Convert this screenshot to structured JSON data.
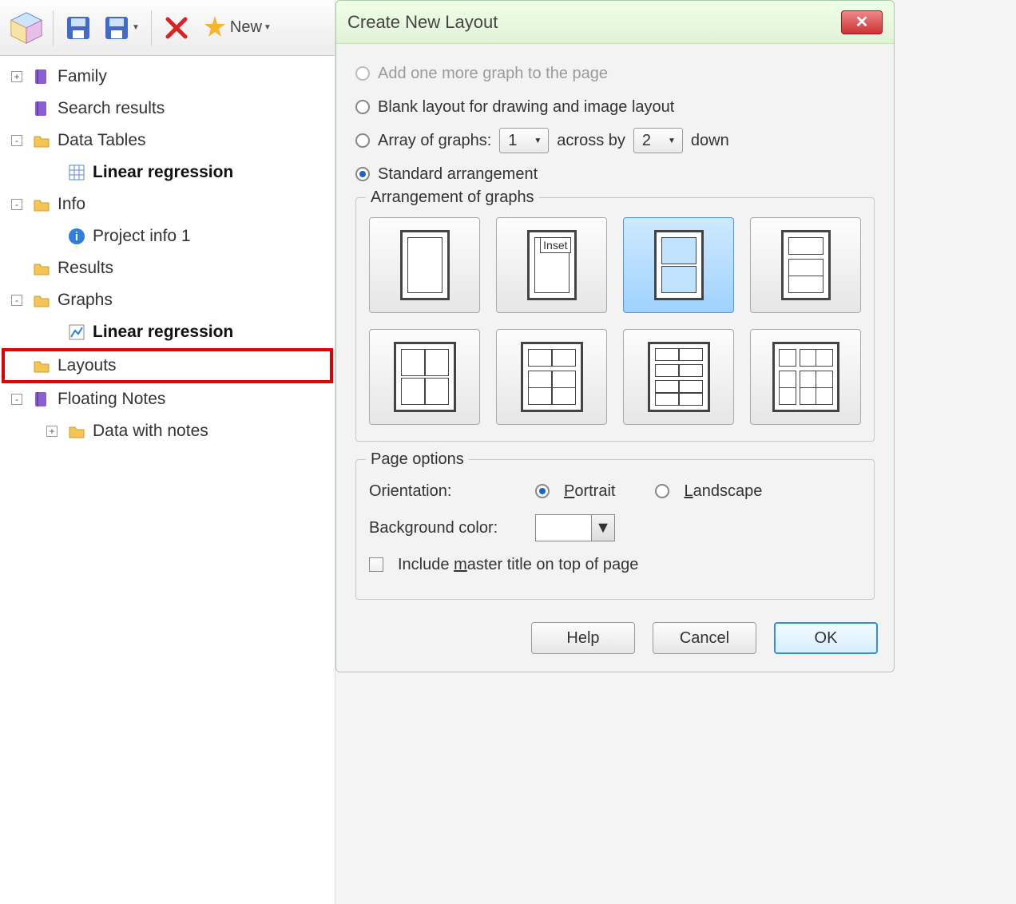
{
  "toolbar": {
    "new_label": "New"
  },
  "tree": {
    "items": [
      {
        "label": "Family",
        "bold": false,
        "expander": "+",
        "icon": "book-purple"
      },
      {
        "label": "Search results",
        "bold": false,
        "expander": null,
        "icon": "book-purple"
      },
      {
        "label": "Data Tables",
        "bold": false,
        "expander": "-",
        "icon": "folder-yellow"
      },
      {
        "label": "Linear regression",
        "bold": true,
        "expander": null,
        "icon": "table",
        "child": true
      },
      {
        "label": "Info",
        "bold": false,
        "expander": "-",
        "icon": "folder-yellow"
      },
      {
        "label": "Project info 1",
        "bold": false,
        "expander": null,
        "icon": "info-blue",
        "child": true
      },
      {
        "label": "Results",
        "bold": false,
        "expander": null,
        "icon": "folder-yellow"
      },
      {
        "label": "Graphs",
        "bold": false,
        "expander": "-",
        "icon": "folder-yellow"
      },
      {
        "label": "Linear regression",
        "bold": true,
        "expander": null,
        "icon": "chart",
        "child": true
      },
      {
        "label": "Layouts",
        "bold": false,
        "expander": null,
        "icon": "folder-yellow",
        "highlight": true
      },
      {
        "label": "Floating Notes",
        "bold": false,
        "expander": "-",
        "icon": "book-purple"
      },
      {
        "label": "Data with notes",
        "bold": false,
        "expander": "+",
        "icon": "folder-yellow",
        "child": true
      }
    ]
  },
  "dialog": {
    "title": "Create New Layout",
    "radios": {
      "add_more": "Add one more graph to the page",
      "blank": "Blank layout for drawing and image layout",
      "array_pre": "Array of graphs:",
      "array_mid": "across by",
      "array_post": "down",
      "standard": "Standard arrangement"
    },
    "array_across": "1",
    "array_down": "2",
    "group_arrangement": "Arrangement of graphs",
    "inset_label": "Inset",
    "group_page": "Page options",
    "orientation_label": "Orientation:",
    "orientation_portrait": "Portrait",
    "orientation_landscape": "Landscape",
    "bgcolor_label": "Background color:",
    "include_master": "Include master title on top of page",
    "buttons": {
      "help": "Help",
      "cancel": "Cancel",
      "ok": "OK"
    }
  }
}
